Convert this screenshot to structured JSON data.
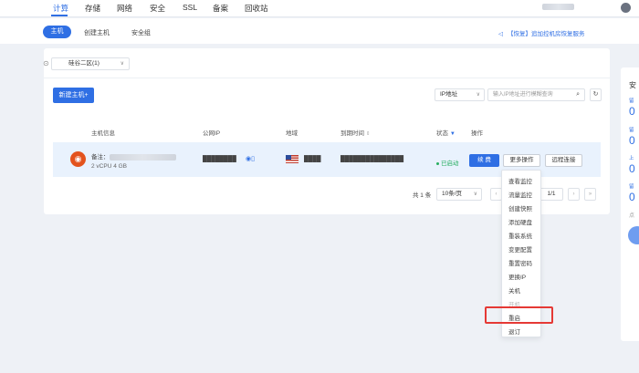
{
  "topnav": {
    "tabs": [
      "计算",
      "存储",
      "网络",
      "安全",
      "SSL",
      "备案",
      "回收站"
    ],
    "username": "███████"
  },
  "subnav": {
    "tabs": [
      "主机",
      "创建主机",
      "安全组"
    ],
    "notice": "【恢复】追加控机房恢复服务"
  },
  "toolbar": {
    "region": "硅谷二区(1)",
    "new_host": "新建主机+",
    "ip_filter": "IP地址",
    "search_placeholder": "输入IP地址进行模糊查询"
  },
  "table": {
    "headers": [
      "主机信息",
      "公网IP",
      "地域",
      "到期时间",
      "状态",
      "操作"
    ],
    "row": {
      "note_label": "备注：",
      "note_value": "████████████████",
      "spec": "2 vCPU   4 GB",
      "ip": "████████",
      "region": "████",
      "expire": "███████████████",
      "status": "已启动",
      "renew": "续 费",
      "more": "更多操作",
      "remote": "远程连接"
    }
  },
  "pager": {
    "total": "共 1 条",
    "page_size": "10条/页",
    "page": "1/1"
  },
  "dropdown": {
    "items": [
      "查看监控",
      "流量监控",
      "创建快照",
      "添加硬盘",
      "重装系统",
      "变更配置",
      "重置密码",
      "更换IP",
      "关机",
      "开机",
      "重启",
      "退订"
    ],
    "highlighted": "重启",
    "disabled": "开机"
  },
  "sidepanel": {
    "title": "安",
    "labels": [
      "留",
      "留",
      "上",
      "留"
    ],
    "values": [
      "0",
      "0",
      "0",
      "0"
    ],
    "link": "点"
  },
  "colors": {
    "accent": "#2f6fe4",
    "status_green": "#27ae60",
    "highlight_red": "#e53935"
  }
}
